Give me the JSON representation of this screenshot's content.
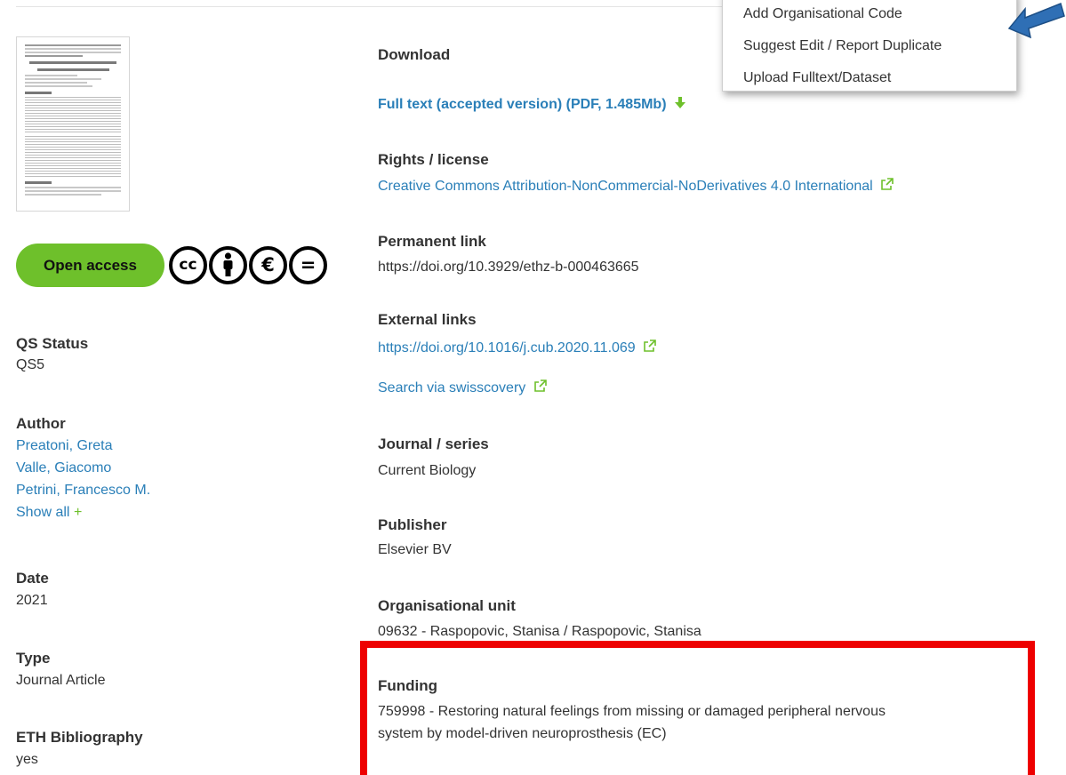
{
  "dropdown": {
    "items": [
      "Add Organisational Code",
      "Suggest Edit / Report Duplicate",
      "Upload Fulltext/Dataset"
    ]
  },
  "left": {
    "open_access_label": "Open access",
    "license_icons": [
      "cc-icon",
      "by-icon",
      "nc-eu-icon",
      "nd-icon"
    ],
    "qs_status": {
      "label": "QS Status",
      "value": "QS5"
    },
    "author": {
      "label": "Author",
      "names": [
        "Preatoni, Greta",
        "Valle, Giacomo",
        "Petrini, Francesco M."
      ],
      "show_all": "Show all",
      "show_all_icon": "+"
    },
    "date": {
      "label": "Date",
      "value": "2021"
    },
    "type": {
      "label": "Type",
      "value": "Journal Article"
    },
    "eth_bibliography": {
      "label": "ETH Bibliography",
      "value": "yes"
    }
  },
  "right": {
    "download": {
      "label": "Download",
      "link": "Full text (accepted version) (PDF, 1.485Mb)"
    },
    "rights": {
      "label": "Rights / license",
      "link": "Creative Commons Attribution-NonCommercial-NoDerivatives 4.0 International"
    },
    "permanent": {
      "label": "Permanent link",
      "value": "https://doi.org/10.3929/ethz-b-000463665"
    },
    "external": {
      "label": "External links",
      "link": "https://doi.org/10.1016/j.cub.2020.11.069",
      "search": "Search via swisscovery"
    },
    "journal": {
      "label": "Journal / series",
      "value": "Current Biology"
    },
    "publisher": {
      "label": "Publisher",
      "value": "Elsevier BV"
    },
    "org_unit": {
      "label": "Organisational unit",
      "value": "09632 - Raspopovic, Stanisa / Raspopovic, Stanisa"
    },
    "funding": {
      "label": "Funding",
      "line1": "759998 - Restoring natural feelings from missing or damaged peripheral nervous",
      "line2": "system by model-driven neuroprosthesis (EC)"
    }
  },
  "colors": {
    "link": "#2a7fb8",
    "badge": "#6ec02b",
    "highlight": "#ee0000",
    "arrow": "#2f6fb5"
  }
}
